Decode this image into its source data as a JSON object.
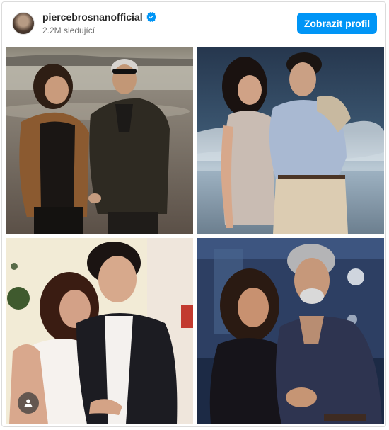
{
  "profile": {
    "username": "piercebrosnanofficial",
    "followers": "2.2M sledující",
    "button_label": "Zobrazit profil"
  },
  "photos": [
    {
      "description_icon": "photo-beach-sunset"
    },
    {
      "description_icon": "photo-beach-vintage"
    },
    {
      "description_icon": "photo-event"
    },
    {
      "description_icon": "photo-indoor"
    }
  ],
  "colors": {
    "accent": "#0095f6",
    "verified": "#0095f6",
    "text": "#262626",
    "muted": "#737373"
  }
}
